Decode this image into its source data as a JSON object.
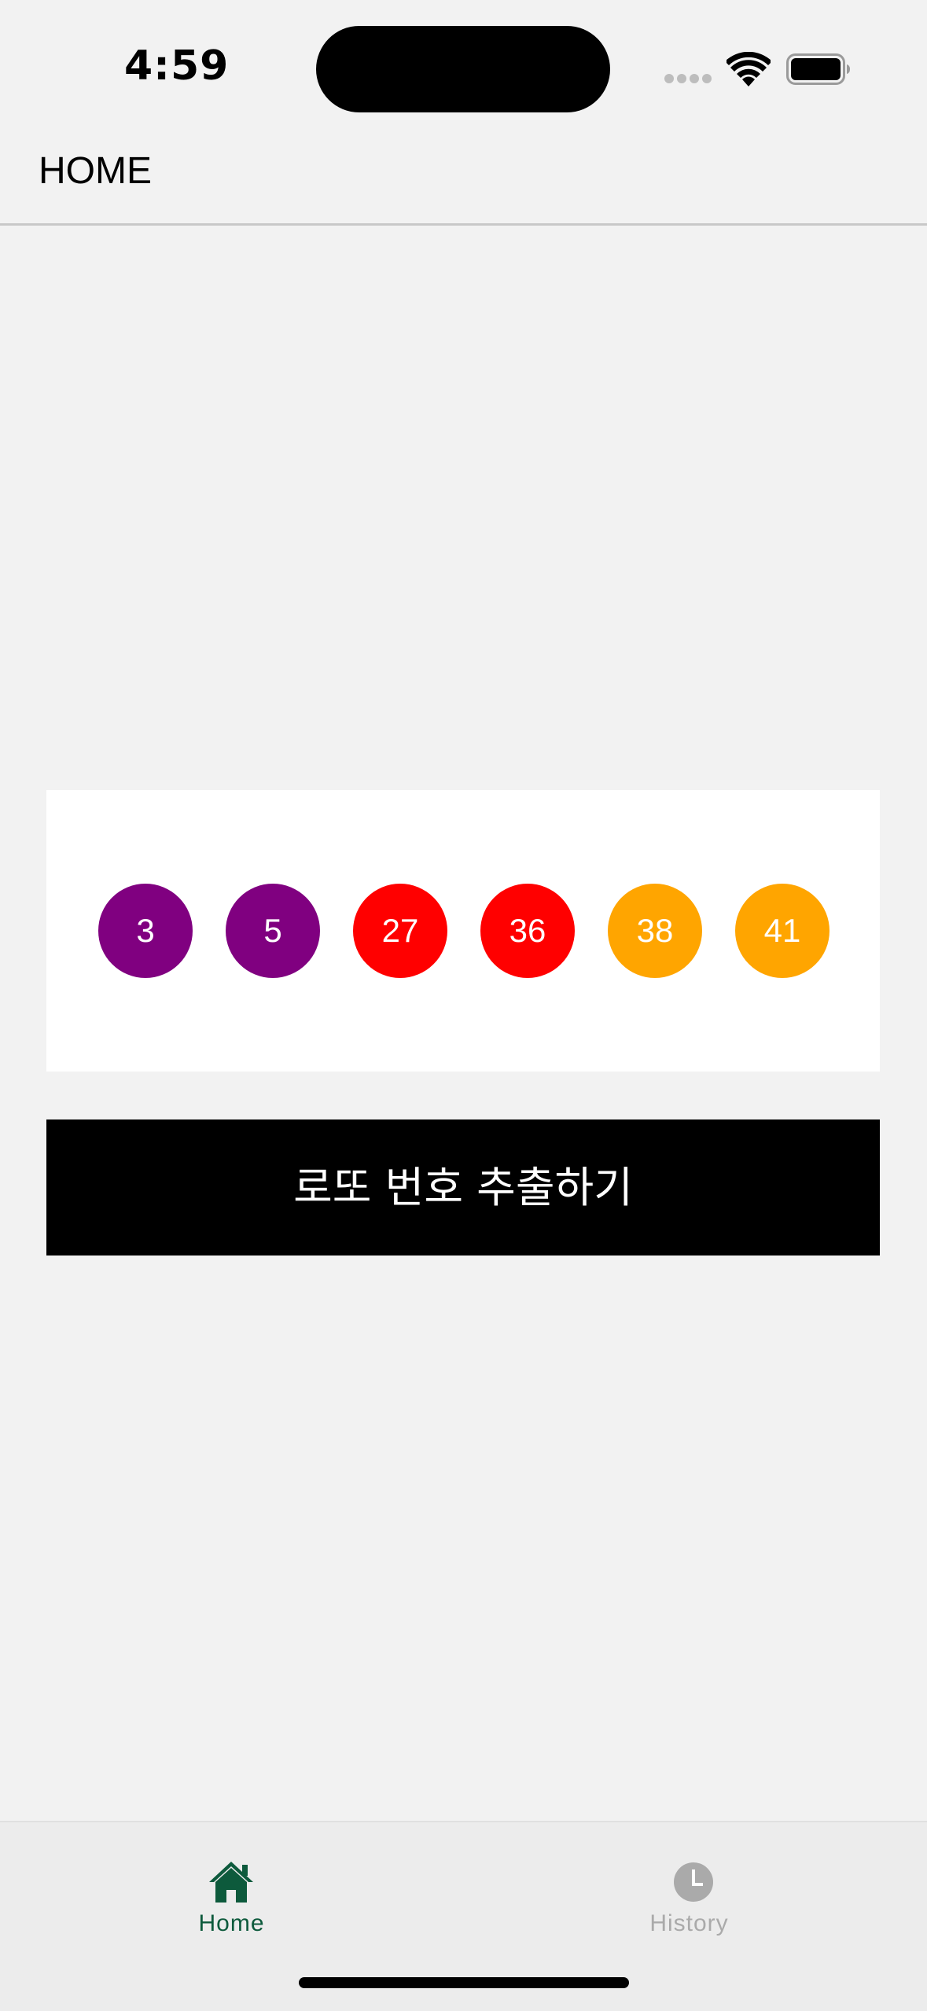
{
  "status_bar": {
    "time": "4:59"
  },
  "header": {
    "title": "HOME"
  },
  "lotto": {
    "balls": [
      {
        "number": "3",
        "color": "#800080"
      },
      {
        "number": "5",
        "color": "#800080"
      },
      {
        "number": "27",
        "color": "#ff0000"
      },
      {
        "number": "36",
        "color": "#ff0000"
      },
      {
        "number": "38",
        "color": "#ffa500"
      },
      {
        "number": "41",
        "color": "#ffa500"
      }
    ]
  },
  "action": {
    "draw_label": "로또 번호 추출하기"
  },
  "tab_bar": {
    "tabs": [
      {
        "label": "Home",
        "icon": "home-icon",
        "active": true,
        "color": "#0d5a3c"
      },
      {
        "label": "History",
        "icon": "clock-icon",
        "active": false,
        "color": "#aaaaaa"
      }
    ]
  }
}
